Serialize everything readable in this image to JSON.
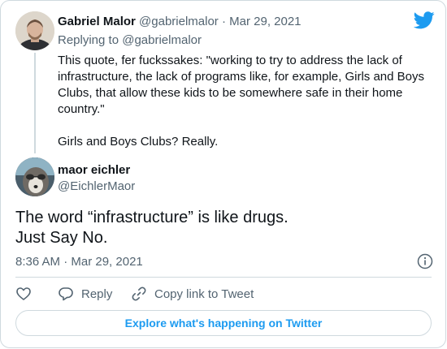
{
  "colors": {
    "brand": "#1d9bf0",
    "text_primary": "#0f1419",
    "text_secondary": "#536471",
    "border": "#cfd9de"
  },
  "logo_icon": "twitter-bird-icon",
  "parent_tweet": {
    "author_name": "Gabriel Malor",
    "author_handle": "@gabrielmalor",
    "separator": "·",
    "date": "Mar 29, 2021",
    "replying_prefix": "Replying to",
    "replying_to": "@gabrielmalor",
    "text": "This quote, fer fuckssakes: \"working to try to address the lack of infrastructure, the lack of programs like, for example, Girls and Boys Clubs, that allow these kids to be somewhere safe in their home country.\"\n\nGirls and Boys Clubs? Really."
  },
  "tweet": {
    "author_name": "maor eichler",
    "author_handle": "@EichlerMaor",
    "text": "The word “infrastructure” is like drugs.\nJust Say No.",
    "timestamp": "8:36 AM · Mar 29, 2021",
    "info_icon": "info-icon"
  },
  "actions": {
    "like_icon": "heart-icon",
    "reply_label": "Reply",
    "reply_icon": "reply-bubble-icon",
    "copy_link_label": "Copy link to Tweet",
    "copy_link_icon": "link-icon"
  },
  "explore_label": "Explore what's happening on Twitter"
}
